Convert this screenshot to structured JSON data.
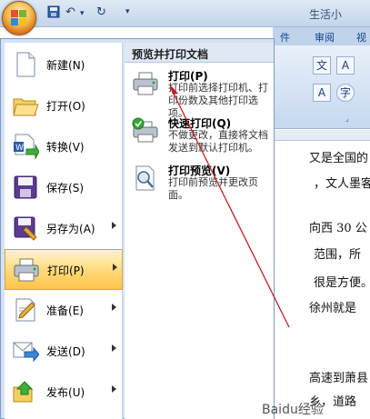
{
  "window": {
    "title": "生活小"
  },
  "ribbon": {
    "tabs": [
      "件",
      "审阅",
      "视"
    ]
  },
  "document": {
    "lines": [
      "又是全国的",
      "，文人墨客",
      "向西 30 公",
      "范围，所",
      "很是方便。",
      "徐州就是",
      "高速到萧县",
      "乡，道路"
    ]
  },
  "office_menu": {
    "items": [
      {
        "label": "新建",
        "key": "(N)",
        "has_arrow": false,
        "icon": "new-document-icon"
      },
      {
        "label": "打开",
        "key": "(O)",
        "has_arrow": false,
        "icon": "open-folder-icon"
      },
      {
        "label": "转换",
        "key": "(V)",
        "has_arrow": false,
        "icon": "convert-icon"
      },
      {
        "label": "保存",
        "key": "(S)",
        "has_arrow": false,
        "icon": "save-icon"
      },
      {
        "label": "另存为",
        "key": "(A)",
        "has_arrow": true,
        "icon": "save-as-icon"
      },
      {
        "label": "打印",
        "key": "(P)",
        "has_arrow": true,
        "icon": "printer-icon",
        "active": true
      },
      {
        "label": "准备",
        "key": "(E)",
        "has_arrow": true,
        "icon": "prepare-icon"
      },
      {
        "label": "发送",
        "key": "(D)",
        "has_arrow": true,
        "icon": "send-icon"
      },
      {
        "label": "发布",
        "key": "(U)",
        "has_arrow": true,
        "icon": "publish-icon"
      }
    ]
  },
  "print_submenu": {
    "heading": "预览并打印文档",
    "items": [
      {
        "title": "打印(P)",
        "desc": "打印前选择打印机、打印份数及其他打印选项。",
        "icon": "printer-icon"
      },
      {
        "title": "快速打印(Q)",
        "desc": "不做更改，直接将文档发送到默认打印机。",
        "icon": "quick-print-icon"
      },
      {
        "title": "打印预览(V)",
        "desc": "打印前预览并更改页面。",
        "icon": "print-preview-icon"
      }
    ]
  },
  "watermark": {
    "text": "Baidu经验"
  },
  "colors": {
    "accent": "#ffc44a",
    "menu_border": "#7d9bc6",
    "annotation_arrow": "#c0202a"
  }
}
